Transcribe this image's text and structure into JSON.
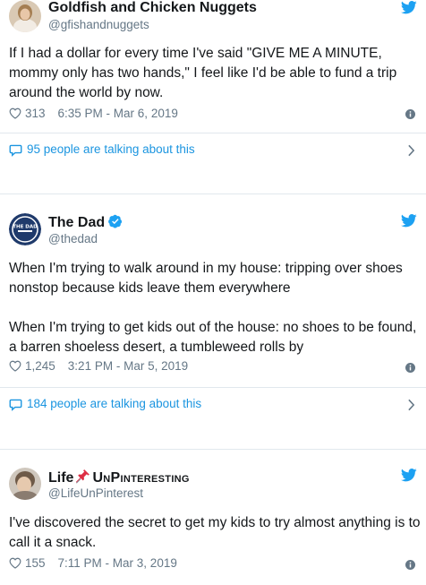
{
  "colors": {
    "link": "#1b95e0",
    "secondary": "#657786",
    "twitter_blue": "#1da1f2",
    "separator": "#e1e8ed"
  },
  "tweets": [
    {
      "name": "Goldfish and Chicken Nuggets",
      "handle": "@gfishandnuggets",
      "text": "If I had a dollar for every time I've said \"GIVE ME A MINUTE, mommy only has two hands,\" I feel like I'd be able to fund a trip around the world by now.",
      "likes": "313",
      "timestamp": "6:35 PM - Mar 6, 2019",
      "talking": "95 people are talking about this"
    },
    {
      "name": "The Dad",
      "avatar_text": "THE DAD",
      "handle": "@thedad",
      "text": "When I'm trying to walk around in my house: tripping over shoes nonstop because kids leave them everywhere\n\nWhen I'm trying to get kids out of the house: no shoes to be found, a barren shoeless desert, a tumbleweed rolls by",
      "likes": "1,245",
      "timestamp": "3:21 PM - Mar 5, 2019",
      "talking": "184 people are talking about this"
    },
    {
      "name_part1": "Life",
      "name_part2": "UnPinteresting",
      "handle": "@LifeUnPinterest",
      "text": "I've discovered the secret to get my kids to try almost anything is to call it a snack.",
      "likes": "155",
      "timestamp": "7:11 PM - Mar 3, 2019"
    }
  ]
}
